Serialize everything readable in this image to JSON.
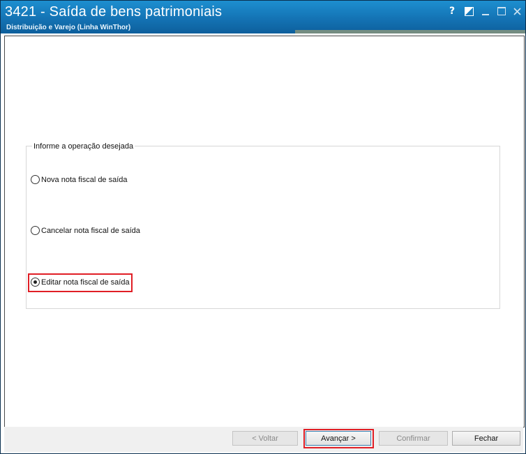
{
  "window": {
    "title": "3421 - Saída de bens patrimoniais",
    "subtitle": "Distribuição e Varejo (Linha WinThor)",
    "buttons": {
      "help": "?"
    }
  },
  "group": {
    "legend": "Informe a operação desejada",
    "options": [
      {
        "label": "Nova nota fiscal de saída",
        "selected": false
      },
      {
        "label": "Cancelar nota fiscal de saída",
        "selected": false
      },
      {
        "label": "Editar nota fiscal de saída",
        "selected": true
      }
    ]
  },
  "footer": {
    "voltar_label": "< Voltar",
    "avancar_label": "Avançar >",
    "confirmar_label": "Confirmar",
    "fechar_label": "Fechar"
  },
  "colors": {
    "title_bar": "#1473b4",
    "highlight": "#e01e25"
  }
}
